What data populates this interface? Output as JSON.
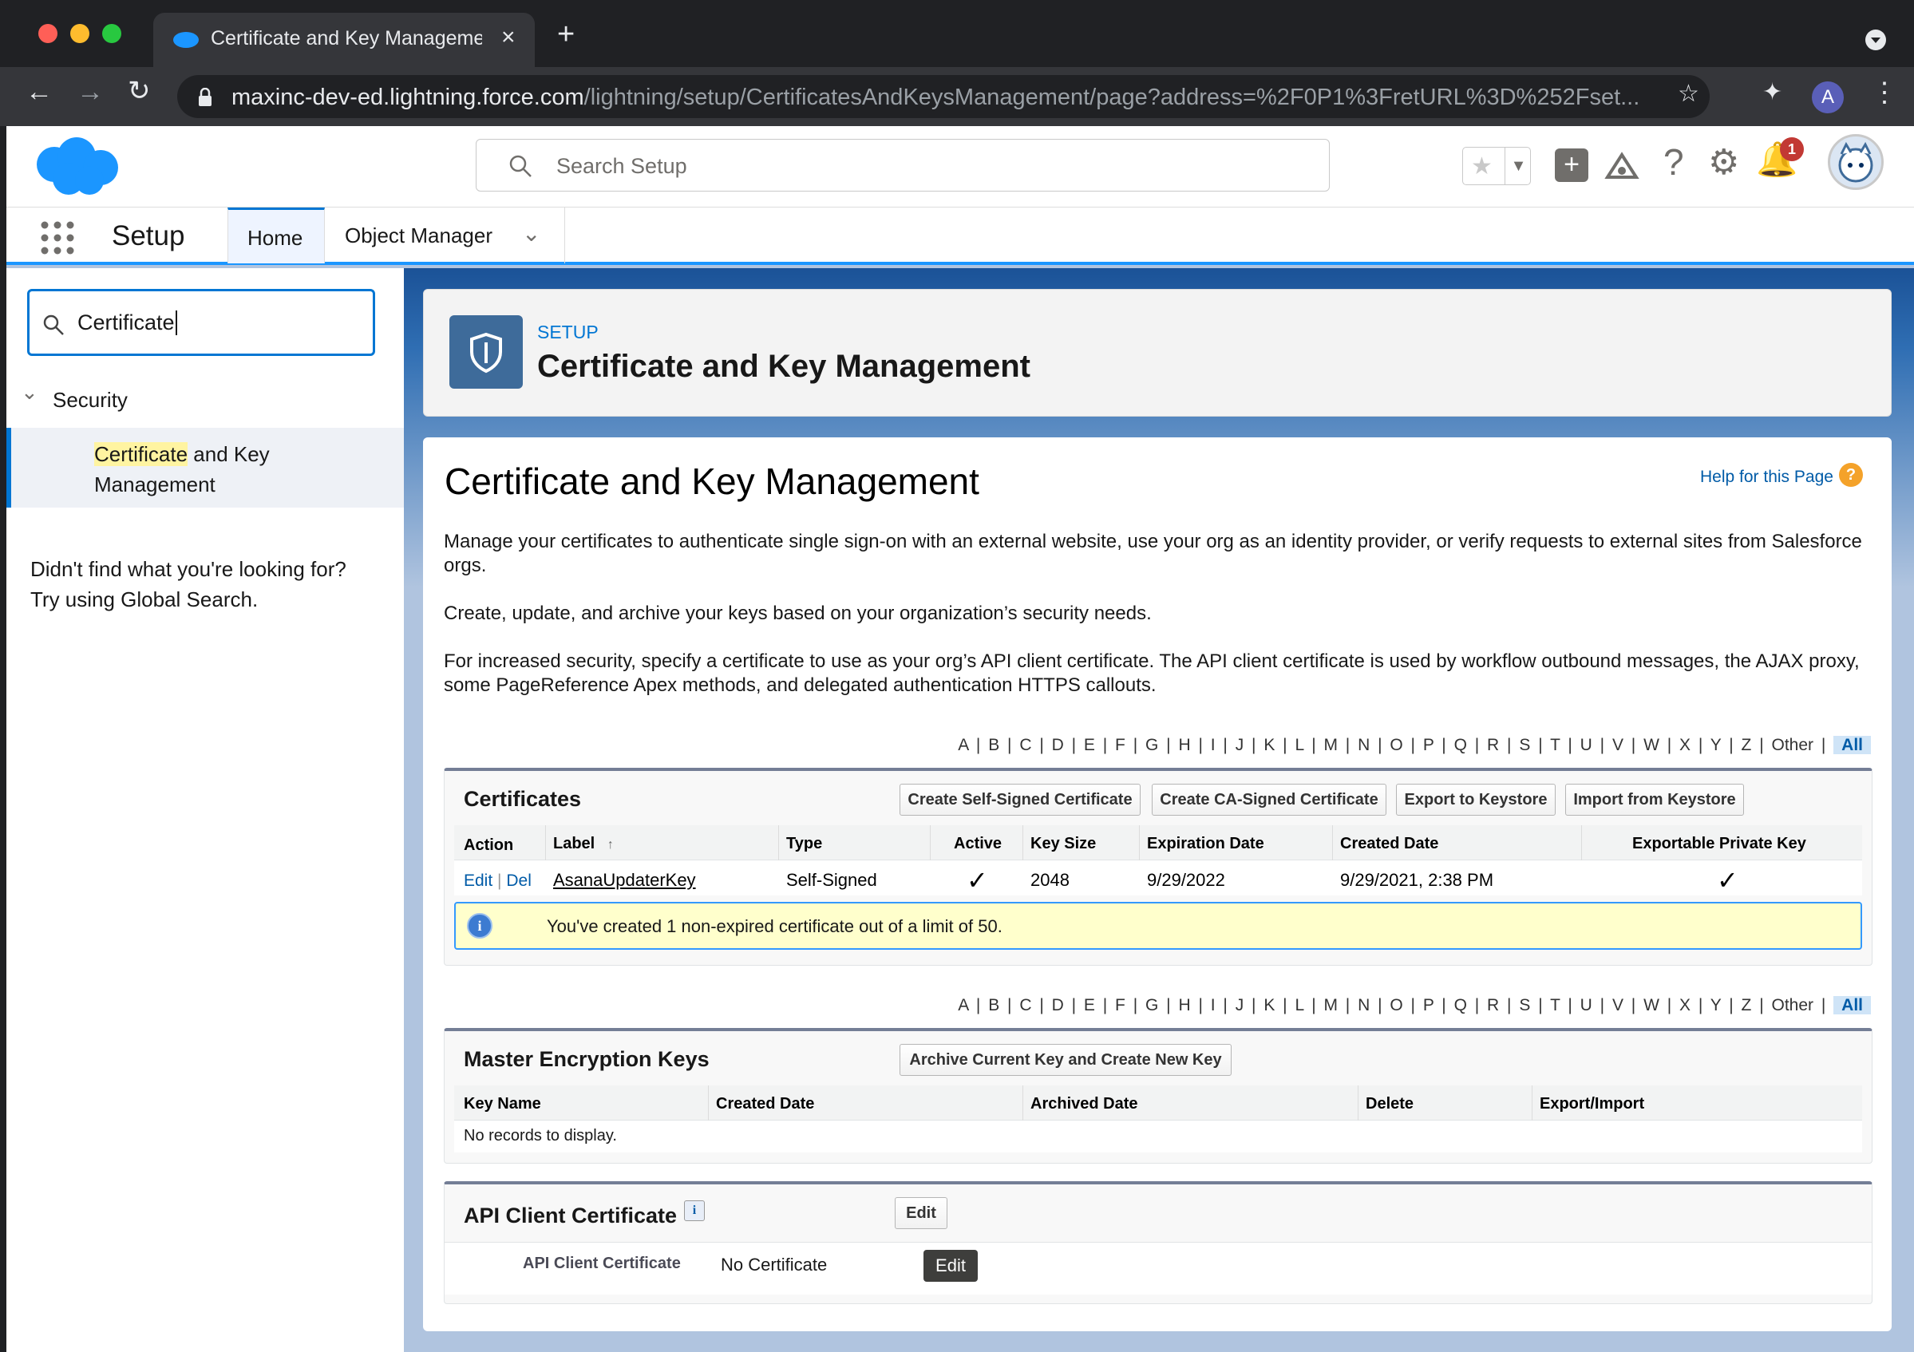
{
  "browser": {
    "tab_title": "Certificate and Key Management",
    "new_tab_glyph": "+",
    "url_host": "maxinc-dev-ed.lightning.force.com",
    "url_path": "/lightning/setup/CertificatesAndKeysManagement/page?address=%2F0P1%3FretURL%3D%252Fset...",
    "profile_initial": "A"
  },
  "sf_header": {
    "search_placeholder": "Search Setup",
    "notification_count": "1"
  },
  "nav": {
    "app_name": "Setup",
    "tabs": [
      {
        "label": "Home"
      },
      {
        "label": "Object Manager"
      }
    ]
  },
  "sidebar": {
    "search_value": "Certificate",
    "section": "Security",
    "item_highlight": "Certificate",
    "item_rest": " and Key",
    "item_line2": "Management",
    "not_found_line1": "Didn't find what you're looking for?",
    "not_found_line2": "Try using Global Search."
  },
  "page_header": {
    "eyebrow": "SETUP",
    "title": "Certificate and Key Management"
  },
  "content": {
    "title": "Certificate and Key Management",
    "help_link": "Help for this Page",
    "para1": "Manage your certificates to authenticate single sign-on with an external website, use your org as an identity provider, or verify requests to external sites from Salesforce orgs.",
    "para2": "Create, update, and archive your keys based on your organization’s security needs.",
    "para3": "For increased security, specify a certificate to use as your org’s API client certificate. The API client certificate is used by workflow outbound messages, the AJAX proxy, some PageReference Apex methods, and delegated authentication HTTPS callouts.",
    "alphabet": "A | B | C | D | E | F | G | H | I | J | K | L | M | N | O | P | Q | R | S | T | U | V | W | X | Y | Z | Other |",
    "alphabet_all": "All"
  },
  "certificates": {
    "title": "Certificates",
    "buttons": [
      "Create Self-Signed Certificate",
      "Create CA-Signed Certificate",
      "Export to Keystore",
      "Import from Keystore"
    ],
    "columns": [
      "Action",
      "Label",
      "Type",
      "Active",
      "Key Size",
      "Expiration Date",
      "Created Date",
      "Exportable Private Key"
    ],
    "sort_glyph": "↑",
    "row": {
      "edit": "Edit",
      "sep": "|",
      "del": "Del",
      "label": "AsanaUpdaterKey",
      "type": "Self-Signed",
      "active": "✓",
      "key_size": "2048",
      "expiration": "9/29/2022",
      "created": "9/29/2021, 2:38 PM",
      "exportable": "✓"
    },
    "info_message": "You've created 1 non-expired certificate out of a limit of 50."
  },
  "master_keys": {
    "title": "Master Encryption Keys",
    "button": "Archive Current Key and Create New Key",
    "columns": [
      "Key Name",
      "Created Date",
      "Archived Date",
      "Delete",
      "Export/Import"
    ],
    "empty": "No records to display."
  },
  "api_cert": {
    "title": "API Client Certificate",
    "edit_button": "Edit",
    "field_label": "API Client Certificate",
    "field_value": "No Certificate",
    "tooltip": "Edit"
  }
}
